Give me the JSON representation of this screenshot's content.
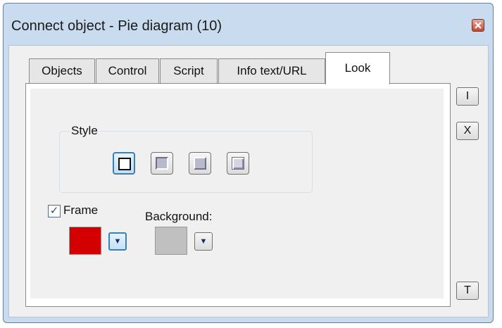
{
  "window": {
    "title": "Connect object - Pie diagram (10)"
  },
  "tabs": [
    {
      "label": "Objects"
    },
    {
      "label": "Control"
    },
    {
      "label": "Script"
    },
    {
      "label": "Info text/URL"
    },
    {
      "label": "Look",
      "active": true
    }
  ],
  "look": {
    "style_group_label": "Style",
    "style_options": [
      "flat-frame",
      "sunken-frame",
      "raised-frame",
      "embossed-frame"
    ],
    "selected_style_index": 0,
    "frame": {
      "label": "Frame",
      "checked": true,
      "color": "#d40000"
    },
    "background": {
      "label": "Background:",
      "color": "#c0c0c0"
    }
  },
  "side_buttons": {
    "ok": "I",
    "cancel": "X",
    "help": "T"
  },
  "colors": {
    "title_bar": "#c9dbef",
    "selected_accent": "#3c7fb1"
  }
}
